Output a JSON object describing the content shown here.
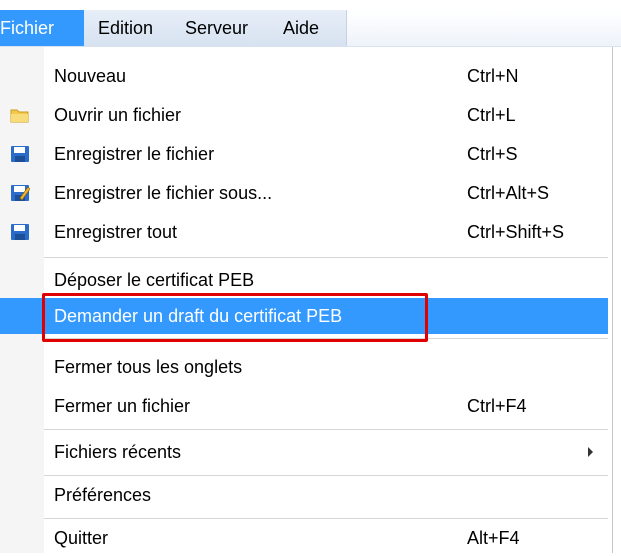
{
  "menubar": {
    "items": [
      {
        "label": "Fichier"
      },
      {
        "label": "Edition"
      },
      {
        "label": "Serveur"
      },
      {
        "label": "Aide"
      }
    ]
  },
  "menu": {
    "items": [
      {
        "label": "Nouveau",
        "shortcut": "Ctrl+N"
      },
      {
        "label": "Ouvrir un fichier",
        "shortcut": "Ctrl+L",
        "icon": "folder-icon"
      },
      {
        "label": "Enregistrer le fichier",
        "shortcut": "Ctrl+S",
        "icon": "floppy-disk-icon"
      },
      {
        "label": "Enregistrer le fichier sous...",
        "shortcut": "Ctrl+Alt+S",
        "icon": "save-as-icon"
      },
      {
        "label": "Enregistrer tout",
        "shortcut": "Ctrl+Shift+S",
        "icon": "floppy-disk-icon"
      },
      {
        "label": "Déposer le certificat PEB"
      },
      {
        "label": "Demander un draft du certificat PEB",
        "highlighted": true
      },
      {
        "label": "Fermer tous les onglets"
      },
      {
        "label": "Fermer un fichier",
        "shortcut": "Ctrl+F4"
      },
      {
        "label": "Fichiers récents",
        "submenu": true
      },
      {
        "label": "Préférences"
      },
      {
        "label": "Quitter",
        "shortcut": "Alt+F4"
      }
    ]
  },
  "colors": {
    "highlight": "#3399ff",
    "annotation": "#e00000"
  }
}
